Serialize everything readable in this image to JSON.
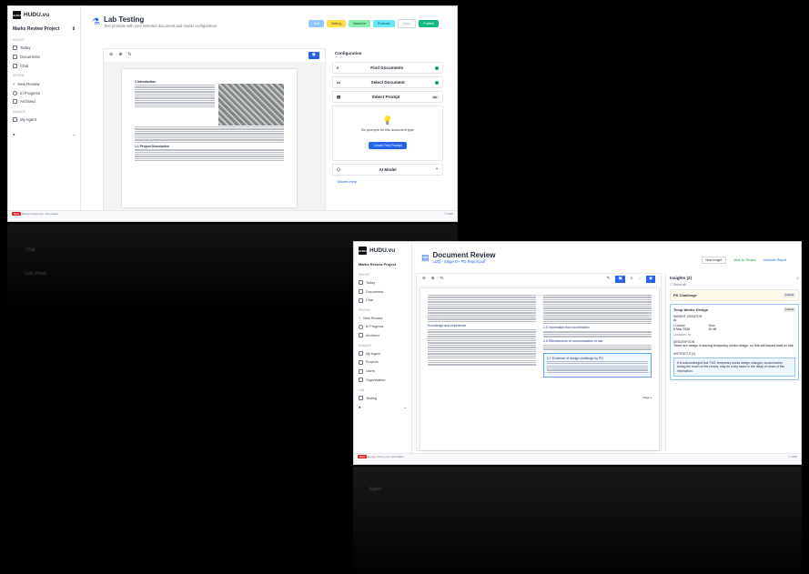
{
  "app": {
    "name": "HUDU.vu",
    "logo_text": "HUDU"
  },
  "window1": {
    "project": "Marks Review Project",
    "sections": {
      "insight": "INSIGHT",
      "review": "REVIEW",
      "manage": "MANAGE"
    },
    "nav_insight": [
      "Today",
      "Documents",
      "Chat"
    ],
    "nav_review": [
      "New Review",
      "In Progress",
      "Archived"
    ],
    "nav_manage": [
      "My Agent"
    ],
    "title": "Lab Testing",
    "subtitle": "Test prompts with your selected document and model configuration",
    "buttons": {
      "test": "Test",
      "setting": "Setting",
      "baseline": "Baseline",
      "evaluate": "Evaluate",
      "save": "Save",
      "publish": "Publish"
    },
    "config_title": "Configuration",
    "config_rows": [
      "Find Documents",
      "Select Document",
      "Select Prompt"
    ],
    "prompt_count": "0/0",
    "no_prompts": "No prompts for this document type",
    "create_prompt": "Create First Prompt",
    "ai_model": "AI Model",
    "models_help": "Models Help",
    "doc_section_1": "1 Introduction",
    "doc_section_2": "1.1 Project Description",
    "footer_left": "Beta",
    "footer_sub": "Always check your information",
    "footer_right": "© 2025"
  },
  "window2": {
    "project": "Marks Review Project",
    "sections": {
      "insight": "INSIGHT",
      "review": "REVIEW",
      "manage": "MANAGE",
      "lab": "LAB"
    },
    "nav_insight": [
      "Today",
      "Documents",
      "Chat"
    ],
    "nav_review": [
      "New Review",
      "In Progress",
      "Archived"
    ],
    "nav_manage": [
      "My Agent",
      "Projects",
      "Users",
      "Organisation"
    ],
    "nav_lab": [
      "Testing"
    ],
    "title": "Document Review",
    "subtitle": "LDQ - Stage D+ PD Report.pdf",
    "header_actions": [
      "New Insight",
      "Mark for Review",
      "Generate Report"
    ],
    "insights_title": "Insights (2)",
    "select_all": "Select all",
    "insight_items": [
      {
        "title": "PD Challenge",
        "tag": "Critical"
      },
      {
        "title": "Temp Works Design",
        "tag": "Critical"
      }
    ],
    "insight_creator_label": "INSIGHT CREATOR",
    "creator": "AI",
    "created_label": "Created",
    "created_date": "6 Mar 2026",
    "time_label": "Time",
    "time": "10:48",
    "location_label": "Location: xx",
    "description_label": "DESCRIPTION",
    "description": "There are delays in issuing temporary works design, so this will impact start on site.",
    "artifacts_label": "ARTIFACTS (1)",
    "artifact_text": "It is acknowledged that TWC temporary works design changes, issued earlier during the reach of this review, may be a key factor in the delay of views of this information.",
    "doc_headings": [
      "Knowledge and experience",
      "2.5 Information flow coordination",
      "2.6 Effectiveness of communication of risk",
      "2.7 Evidence of design challenge by PD"
    ],
    "page_label": "Page 1",
    "footer_left": "Beta",
    "footer_sub": "Always check your information",
    "footer_right": "© 2025"
  },
  "reflection": {
    "chat": "Chat",
    "lab": "Lab Views",
    "agent": "Agent"
  }
}
